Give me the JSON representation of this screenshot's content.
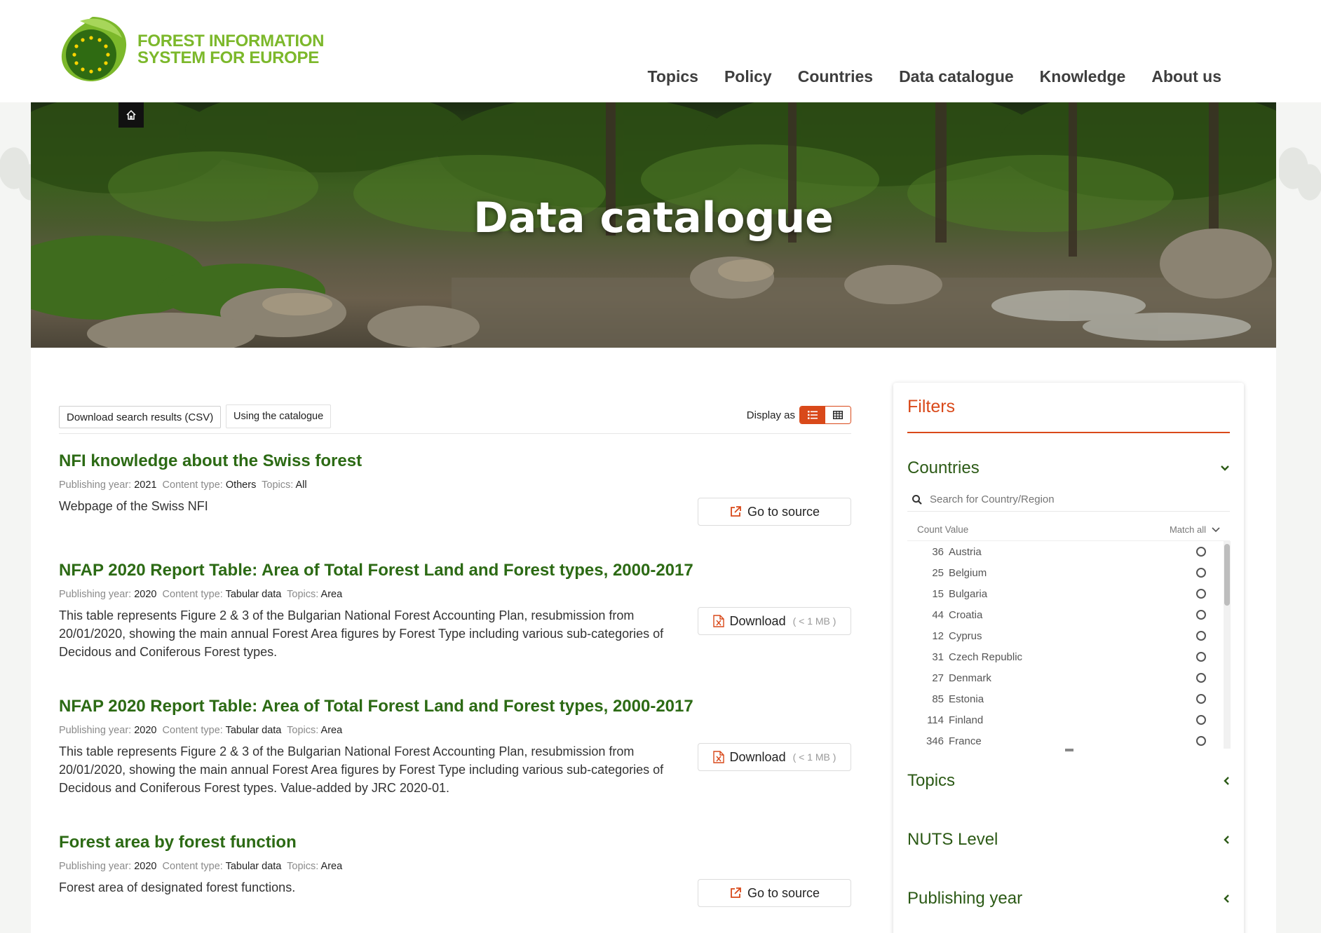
{
  "logo": {
    "line1": "FOREST INFORMATION",
    "line2": "SYSTEM FOR EUROPE"
  },
  "nav": [
    "Topics",
    "Policy",
    "Countries",
    "Data catalogue",
    "Knowledge",
    "About us"
  ],
  "hero": {
    "title": "Data catalogue"
  },
  "toolbar": {
    "download_csv": "Download search results (CSV)",
    "using_catalogue": "Using the catalogue",
    "display_as": "Display as"
  },
  "results": [
    {
      "title": "NFI knowledge about the Swiss forest",
      "year_label": "Publishing year:",
      "year": "2021",
      "type_label": "Content type:",
      "type": "Others",
      "topics_label": "Topics:",
      "topics": "All",
      "description": "Webpage of the Swiss NFI",
      "action": "Go to source",
      "size": ""
    },
    {
      "title": "NFAP 2020 Report Table: Area of Total Forest Land and Forest types, 2000-2017",
      "year_label": "Publishing year:",
      "year": "2020",
      "type_label": "Content type:",
      "type": "Tabular data",
      "topics_label": "Topics:",
      "topics": "Area",
      "description": "This table represents Figure 2 & 3 of the Bulgarian National Forest Accounting Plan, resubmission from 20/01/2020, showing the main annual Forest Area figures by Forest Type including various sub-categories of Decidous and Coniferous Forest types.",
      "action": "Download",
      "size": "( < 1 MB )"
    },
    {
      "title": "NFAP 2020 Report Table: Area of Total Forest Land and Forest types, 2000-2017",
      "year_label": "Publishing year:",
      "year": "2020",
      "type_label": "Content type:",
      "type": "Tabular data",
      "topics_label": "Topics:",
      "topics": "Area",
      "description": "This table represents Figure 2 & 3 of the Bulgarian National Forest Accounting Plan, resubmission from 20/01/2020, showing the main annual Forest Area figures by Forest Type including various sub-categories of Decidous and Coniferous Forest types. Value-added by JRC 2020-01.",
      "action": "Download",
      "size": "( < 1 MB )"
    },
    {
      "title": "Forest area by forest function",
      "year_label": "Publishing year:",
      "year": "2020",
      "type_label": "Content type:",
      "type": "Tabular data",
      "topics_label": "Topics:",
      "topics": "Area",
      "description": "Forest area of designated forest functions.",
      "action": "Go to source",
      "size": ""
    }
  ],
  "filters": {
    "title": "Filters",
    "countries": {
      "label": "Countries",
      "search_placeholder": "Search for Country/Region",
      "count_value_label": "Count Value",
      "match_label": "Match all",
      "items": [
        {
          "count": "36",
          "name": "Austria"
        },
        {
          "count": "25",
          "name": "Belgium"
        },
        {
          "count": "15",
          "name": "Bulgaria"
        },
        {
          "count": "44",
          "name": "Croatia"
        },
        {
          "count": "12",
          "name": "Cyprus"
        },
        {
          "count": "31",
          "name": "Czech Republic"
        },
        {
          "count": "27",
          "name": "Denmark"
        },
        {
          "count": "85",
          "name": "Estonia"
        },
        {
          "count": "114",
          "name": "Finland"
        },
        {
          "count": "346",
          "name": "France"
        }
      ]
    },
    "topics_label": "Topics",
    "nuts_label": "NUTS Level",
    "year_label": "Publishing year"
  },
  "colors": {
    "brand_green": "#7cb82b",
    "title_green": "#2c6a14",
    "accent_orange": "#d9491a"
  }
}
